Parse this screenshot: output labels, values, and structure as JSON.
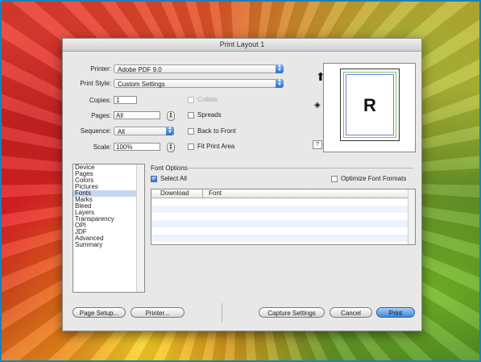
{
  "dialog": {
    "title": "Print Layout 1",
    "printer": {
      "label": "Printer:",
      "value": "Adobe PDF 9.0"
    },
    "print_style": {
      "label": "Print Style:",
      "value": "Custom Settings"
    },
    "copies": {
      "label": "Copies:",
      "value": "1"
    },
    "pages": {
      "label": "Pages:",
      "value": "All"
    },
    "sequence": {
      "label": "Sequence:",
      "value": "All"
    },
    "scale": {
      "label": "Scale:",
      "value": "100%"
    },
    "checkboxes": {
      "collate": "Collate",
      "spreads": "Spreads",
      "back_to_front": "Back to Front",
      "fit_print_area": "Fit Print Area"
    },
    "preview": {
      "letter": "R",
      "help": "?"
    },
    "categories": [
      "Device",
      "Pages",
      "Colors",
      "Pictures",
      "Fonts",
      "Marks",
      "Bleed",
      "Layers",
      "Transparency",
      "OPI",
      "JDF",
      "Advanced",
      "Summary"
    ],
    "selected_category": "Fonts",
    "font_options": {
      "heading": "Font Options",
      "select_all": "Select All",
      "optimize": "Optimize Font Formats",
      "columns": [
        "Download",
        "Font"
      ]
    },
    "buttons": {
      "page_setup": "Page Setup...",
      "printer": "Printer...",
      "capture": "Capture Settings",
      "cancel": "Cancel",
      "print": "Print"
    }
  },
  "colors": {
    "accent": "#3f86dc",
    "frame": "#1e7fb8"
  }
}
